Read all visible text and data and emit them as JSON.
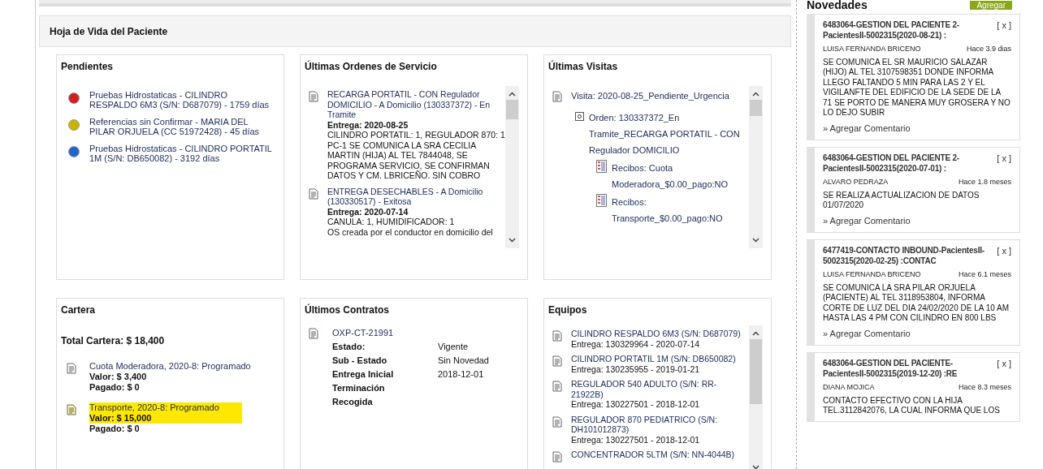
{
  "main": {
    "title": "Hoja de Vida del Paciente",
    "pendientes": {
      "title": "Pendientes",
      "items": [
        {
          "text": "Pruebas Hidrostaticas - CILINDRO RESPALDO 6M3 (S/N: D687079) - 1759 días",
          "color": "#cc2222"
        },
        {
          "text": "Referencias sin Confirmar - MARIA DEL PILAR ORJUELA (CC 51972428) - 45 días",
          "color": "#c8b400"
        },
        {
          "text": "Pruebas Hidrostaticas - CILINDRO PORTATIL 1M (S/N: DB650082) - 3192 días",
          "color": "#2266cc"
        }
      ]
    },
    "ordenes": {
      "title": "Últimas Ordenes de Servicio",
      "items": [
        {
          "title": "RECARGA PORTATIL - CON Regulador DOMICILIO - A Domicilio (130337372) - En Tramite",
          "entrega": "Entrega: 2020-08-25",
          "detail": "CILINDRO PORTATIL: 1, REGULADOR 870: 1 PC-1 SE COMUNICA LA SRA CECILIA MARTIN (HIJA) AL TEL 7844048, SE PROGRAMA SERVICIO, SE CONFIRMAN DATOS Y CM. LBRICEÑO. SIN COBRO"
        },
        {
          "title": "ENTREGA DESECHABLES - A Domicilio (130330517) - Exitosa",
          "entrega": "Entrega: 2020-07-14",
          "detail": "CANULA: 1, HUMIDIFICADOR: 1\nOS creada por el conductor en domicilio del"
        }
      ]
    },
    "visitas": {
      "title": "Últimas Visitas",
      "visita": "Visita: 2020-08-25_Pendiente_Urgencia",
      "orden": "Orden: 130337372_En Tramite_RECARGA PORTATIL - CON Regulador DOMICILIO",
      "recibos": [
        "Recibos: Cuota Moderadora_$0.00_pago:NO",
        "Recibos: Transporte_$0.00_pago:NO"
      ]
    },
    "cartera": {
      "title": "Cartera",
      "total": "Total Cartera: $ 18,400",
      "items": [
        {
          "title": "Cuota Moderadora, 2020-8: Programado",
          "valor": "Valor: $ 3,400",
          "pagado": "Pagado: $ 0",
          "highlighted": false
        },
        {
          "title": "Transporte, 2020-8: Programado",
          "valor": "Valor: $ 15,000",
          "pagado": "Pagado: $ 0",
          "highlighted": true
        }
      ]
    },
    "contratos": {
      "title": "Últimos Contratos",
      "code": "OXP-CT-21991",
      "fields": [
        {
          "label": "Estado:",
          "value": "Vigente"
        },
        {
          "label": "Sub - Estado",
          "value": "Sin Novedad"
        },
        {
          "label": "Entrega Inicial",
          "value": "2018-12-01"
        },
        {
          "label": "Terminación"
        },
        {
          "label": "Recogida"
        }
      ]
    },
    "equipos": {
      "title": "Equipos",
      "items": [
        {
          "name": "CILINDRO RESPALDO 6M3 (S/N: D687079)",
          "entrega": "Entrega: 130329964 - 2020-07-14"
        },
        {
          "name": "CILINDRO PORTATIL 1M (S/N: DB650082)",
          "entrega": "Entrega: 130235955 - 2019-01-21"
        },
        {
          "name": "REGULADOR 540 ADULTO (S/N: RR-21922B)",
          "entrega": "Entrega: 130227501 - 2018-12-01"
        },
        {
          "name": "REGULADOR 870 PEDIATRICO (S/N: DH101012873)",
          "entrega": "Entrega: 130227501 - 2018-12-01"
        },
        {
          "name": "CONCENTRADOR 5LTM (S/N: NN-4044B)"
        }
      ]
    }
  },
  "novedades": {
    "title": "Novedades",
    "add_button": "Agregar",
    "cards": [
      {
        "title": "6483064-GESTION DEL PACIENTE 2-PacientesII-5002315(2020-08-21) :",
        "close": "[ x ]",
        "author": "LUISA FERNANDA BRICENO",
        "time": "Hace 3.9 dias",
        "body": "SE COMUNICA EL SR MAURICIO SALAZAR (HIJO) AL TEL 3107598351 DONDE INFORMA LLEGO FALTANDO 5 MIN PARA LAS 2 Y EL VIGILANFTE DEL EDIFICIO DE LA SEDE DE LA 71 SE PORTO DE MANERA MUY GROSERA Y NO LO DEJO SUBIR",
        "link": "» Agregar Comentario"
      },
      {
        "title": "6483064-GESTION DEL PACIENTE 2-PacientesII-5002315(2020-07-01) :",
        "close": "[ x ]",
        "author": "ALVARO PEDRAZA",
        "time": "Hace 1.8 meses",
        "body": "SE REALIZA ACTUALIZACION DE DATOS 01/07/2020",
        "link": "» Agregar Comentario"
      },
      {
        "title": "6477419-CONTACTO INBOUND-PacientesII-5002315(2020-02-25) :CONTAC",
        "close": "[ x ]",
        "author": "LUISA FERNANDA BRICENO",
        "time": "Hace 6.1 meses",
        "body": "SE COMUNICA LA SRA PILAR ORJUELA (PACIENTE) AL TEL 3118953804, INFORMA CORTE DE LUZ DEL DIA 24/02/2020 DE LA 10 AM HASTA LAS 4 PM CON CILINDRO EN 800 LBS",
        "link": "» Agregar Comentario"
      },
      {
        "title": "6483064-GESTION DEL PACIENTE-PacientesII-5002315(2019-12-20) :RE",
        "close": "[ x ]",
        "author": "DIANA MOJICA",
        "time": "Hace 8.3 meses",
        "body": "CONTACTO EFECTIVO CON LA HIJA TEL.3112842076, LA CUAL INFORMA QUE LOS"
      }
    ]
  }
}
